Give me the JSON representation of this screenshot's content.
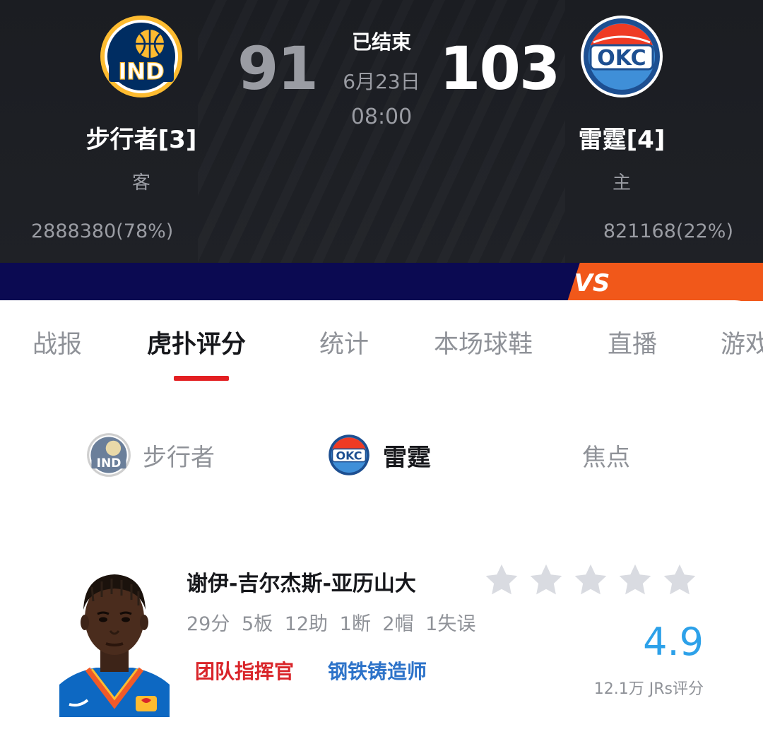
{
  "game": {
    "status": "已结束",
    "date": "6月23日",
    "time": "08:00",
    "away": {
      "name": "步行者[3]",
      "side": "客",
      "score": "91",
      "support_text": "2888380(78%)",
      "support_fraction": 0.78,
      "logo_text": "IND"
    },
    "home": {
      "name": "雷霆[4]",
      "side": "主",
      "score": "103",
      "support_text": "821168(22%)",
      "support_fraction": 0.22,
      "logo_text": "OKC"
    }
  },
  "tabs": [
    {
      "label": "战报",
      "active": false
    },
    {
      "label": "虎扑评分",
      "active": true
    },
    {
      "label": "统计",
      "active": false
    },
    {
      "label": "本场球鞋",
      "active": false
    },
    {
      "label": "直播",
      "active": false
    },
    {
      "label": "游戏",
      "active": false
    }
  ],
  "filters": [
    {
      "label": "步行者",
      "logo": "ind-logo",
      "active": false
    },
    {
      "label": "雷霆",
      "logo": "okc-logo",
      "active": true
    },
    {
      "label": "焦点",
      "logo": "",
      "active": false
    }
  ],
  "player": {
    "name": "谢伊-吉尔杰斯-亚历山大",
    "stats": "29分  5板  12助  1断  2帽  1失误",
    "tags": [
      "团队指挥官",
      "钢铁铸造师"
    ],
    "rating": "4.9",
    "rating_count": "12.1万 JRs评分",
    "stars_total": 5,
    "stars_filled": 0,
    "jersey_badge": "Love's"
  },
  "colors": {
    "header_bg": "#1f2126",
    "away_bar": "#0b0a52",
    "home_bar": "#f1581a",
    "accent_red": "#e31f22",
    "rating_blue": "#2da1e9",
    "tag_red": "#d9252a",
    "tag_blue": "#2d73c9",
    "star_gray": "#d9dbe1"
  }
}
